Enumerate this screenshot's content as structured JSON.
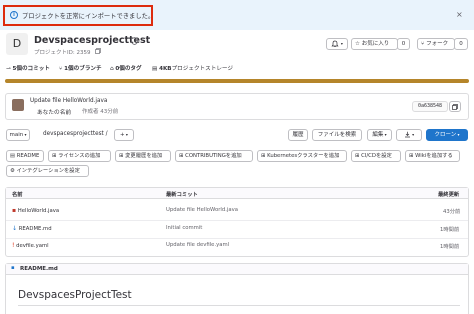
{
  "alert": {
    "text": "プロジェクトを正常にインポートできました。",
    "close": "×",
    "info": "i"
  },
  "project": {
    "avatar_letter": "D",
    "title": "Devspacesprojecttest",
    "id_text": "プロジェクトID: 2359",
    "visibility_icon": "shield-icon"
  },
  "actions": {
    "notify_icon": "bell-icon",
    "star_label": "お気に入り",
    "star_count": "0",
    "fork_label": "フォーク",
    "fork_count": "0"
  },
  "stats": {
    "commits": "5個のコミット",
    "branches": "1個のブランチ",
    "tags": "0個のタグ",
    "storage": "4KB",
    "storage_label": "プロジェクトストレージ"
  },
  "last_commit": {
    "title": "Update file HelloWorld.java",
    "author": "あなたの名前",
    "time": "作成者 43分前",
    "sha": "0a638548"
  },
  "toolbar": {
    "branch": "main",
    "path": "devspacesprojecttest /",
    "plus": "+",
    "history": "履歴",
    "find_file": "ファイルを検索",
    "edit": "編集",
    "clone": "クローン"
  },
  "chips": {
    "row1": [
      "README",
      "ライセンスの追加",
      "変更履歴を追加",
      "CONTRIBUTINGを追加",
      "Kubernetesクラスターを追加",
      "CI/CDを設定",
      "Wikiを追加する"
    ],
    "row2": [
      "インテグレーションを設定"
    ]
  },
  "table": {
    "headers": [
      "名前",
      "最新コミット",
      "最終更新"
    ],
    "rows": [
      {
        "name": "HelloWorld.java",
        "commit": "Update file HelloWorld.java",
        "time": "43分前"
      },
      {
        "name": "README.md",
        "commit": "Initial commit",
        "time": "1時間前"
      },
      {
        "name": "devfile.yaml",
        "commit": "Update file devfile.yaml",
        "time": "1時間前"
      }
    ]
  },
  "readme": {
    "label": "README.md",
    "heading": "DevspacesProjectTest"
  },
  "colors": {
    "accent": "#1f75cb",
    "alert_bg": "#e9f3fc",
    "alert_border": "#dd2b0e",
    "storage_bar": "#b5852a"
  }
}
